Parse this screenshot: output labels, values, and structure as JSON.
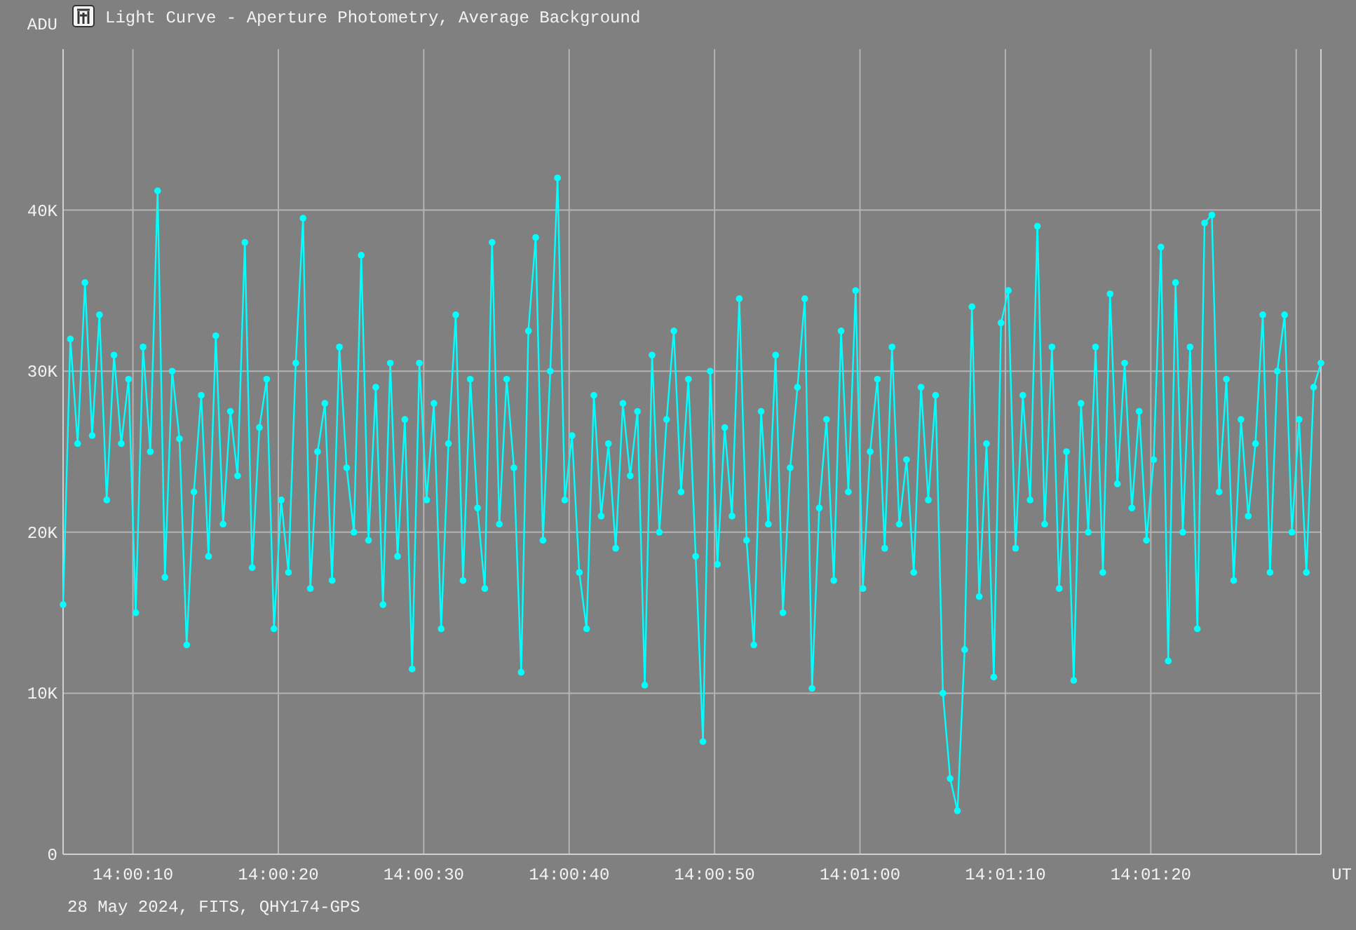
{
  "window": {
    "title": "Light Curve - Aperture Photometry, Average Background"
  },
  "chart": {
    "chart_data": {
      "type": "line",
      "ylabel": "ADU",
      "xlabel": "UT",
      "xlim": [
        50405.2,
        50491.7
      ],
      "ylim": [
        0,
        50000
      ],
      "grid": true,
      "x": [
        50405.2,
        50405.7,
        50406.2,
        50406.7,
        50407.2,
        50407.7,
        50408.2,
        50408.7,
        50409.2,
        50409.7,
        50410.2,
        50410.7,
        50411.2,
        50411.7,
        50412.2,
        50412.7,
        50413.2,
        50413.7,
        50414.2,
        50414.7,
        50415.2,
        50415.7,
        50416.2,
        50416.7,
        50417.2,
        50417.7,
        50418.2,
        50418.7,
        50419.2,
        50419.7,
        50420.2,
        50420.7,
        50421.2,
        50421.7,
        50422.2,
        50422.7,
        50423.2,
        50423.7,
        50424.2,
        50424.7,
        50425.2,
        50425.7,
        50426.2,
        50426.7,
        50427.2,
        50427.7,
        50428.2,
        50428.7,
        50429.2,
        50429.7,
        50430.2,
        50430.7,
        50431.2,
        50431.7,
        50432.2,
        50432.7,
        50433.2,
        50433.7,
        50434.2,
        50434.7,
        50435.2,
        50435.7,
        50436.2,
        50436.7,
        50437.2,
        50437.7,
        50438.2,
        50438.7,
        50439.2,
        50439.7,
        50440.2,
        50440.7,
        50441.2,
        50441.7,
        50442.2,
        50442.7,
        50443.2,
        50443.7,
        50444.2,
        50444.7,
        50445.2,
        50445.7,
        50446.2,
        50446.7,
        50447.2,
        50447.7,
        50448.2,
        50448.7,
        50449.2,
        50449.7,
        50450.2,
        50450.7,
        50451.2,
        50451.7,
        50452.2,
        50452.7,
        50453.2,
        50453.7,
        50454.2,
        50454.7,
        50455.2,
        50455.7,
        50456.2,
        50456.7,
        50457.2,
        50457.7,
        50458.2,
        50458.7,
        50459.2,
        50459.7,
        50460.2,
        50460.7,
        50461.2,
        50461.7,
        50462.2,
        50462.7,
        50463.2,
        50463.7,
        50464.2,
        50464.7,
        50465.2,
        50465.7,
        50466.2,
        50466.7,
        50467.2,
        50467.7,
        50468.2,
        50468.7,
        50469.2,
        50469.7,
        50470.2,
        50470.7,
        50471.2,
        50471.7,
        50472.2,
        50472.7,
        50473.2,
        50473.7,
        50474.2,
        50474.7,
        50475.2,
        50475.7,
        50476.2,
        50476.7,
        50477.2,
        50477.7,
        50478.2,
        50478.7,
        50479.2,
        50479.7,
        50480.2,
        50480.7,
        50481.2,
        50481.7,
        50482.2,
        50482.7,
        50483.2,
        50483.7,
        50484.2,
        50484.7,
        50485.2,
        50485.7,
        50486.2,
        50486.7,
        50487.2,
        50487.7,
        50488.2,
        50488.7,
        50489.2,
        50489.7,
        50490.2,
        50490.7,
        50491.2,
        50491.7
      ],
      "xticks": [
        {
          "value": 50410,
          "label": "14:00:10"
        },
        {
          "value": 50420,
          "label": "14:00:20"
        },
        {
          "value": 50430,
          "label": "14:00:30"
        },
        {
          "value": 50440,
          "label": "14:00:40"
        },
        {
          "value": 50450,
          "label": "14:00:50"
        },
        {
          "value": 50460,
          "label": "14:01:00"
        },
        {
          "value": 50470,
          "label": "14:01:10"
        },
        {
          "value": 50480,
          "label": "14:01:20"
        }
      ],
      "yticks": [
        {
          "value": 0,
          "label": "0"
        },
        {
          "value": 10000,
          "label": "10K"
        },
        {
          "value": 20000,
          "label": "20K"
        },
        {
          "value": 30000,
          "label": "30K"
        },
        {
          "value": 40000,
          "label": "40K"
        }
      ],
      "series": [
        {
          "color": "#00ffff",
          "marker": "circle",
          "values": [
            15500,
            32000,
            25500,
            35500,
            26000,
            33500,
            22000,
            31000,
            25500,
            29500,
            15000,
            31500,
            25000,
            41200,
            17200,
            30000,
            25800,
            13000,
            22500,
            28500,
            18500,
            32200,
            20500,
            27500,
            23500,
            38000,
            17800,
            26500,
            29500,
            14000,
            22000,
            17500,
            30500,
            39500,
            16500,
            25000,
            28000,
            17000,
            31500,
            24000,
            20000,
            37200,
            19500,
            29000,
            15500,
            30500,
            18500,
            27000,
            11500,
            30500,
            22000,
            28000,
            14000,
            25500,
            33500,
            17000,
            29500,
            21500,
            16500,
            38000,
            20500,
            29500,
            24000,
            11300,
            32500,
            38300,
            19500,
            30000,
            42000,
            22000,
            26000,
            17500,
            14000,
            28500,
            21000,
            25500,
            19000,
            28000,
            23500,
            27500,
            10500,
            31000,
            20000,
            27000,
            32500,
            22500,
            29500,
            18500,
            7000,
            30000,
            18000,
            26500,
            21000,
            34500,
            19500,
            13000,
            27500,
            20500,
            31000,
            15000,
            24000,
            29000,
            34500,
            10300,
            21500,
            27000,
            17000,
            32500,
            22500,
            35000,
            16500,
            25000,
            29500,
            19000,
            31500,
            20500,
            24500,
            17500,
            29000,
            22000,
            28500,
            10000,
            4700,
            2700,
            12700,
            34000,
            16000,
            25500,
            11000,
            33000,
            35000,
            19000,
            28500,
            22000,
            39000,
            20500,
            31500,
            16500,
            25000,
            10800,
            28000,
            20000,
            31500,
            17500,
            34800,
            23000,
            30500,
            21500,
            27500,
            19500,
            24500,
            37700,
            12000,
            35500,
            20000,
            31500,
            14000,
            39200,
            39700,
            22500,
            29500,
            17000,
            27000,
            21000,
            25500,
            33500,
            17500,
            30000,
            33500,
            20000,
            27000,
            17500,
            29000,
            30500
          ]
        }
      ]
    }
  },
  "footer": "28 May 2024, FITS, QHY174-GPS"
}
